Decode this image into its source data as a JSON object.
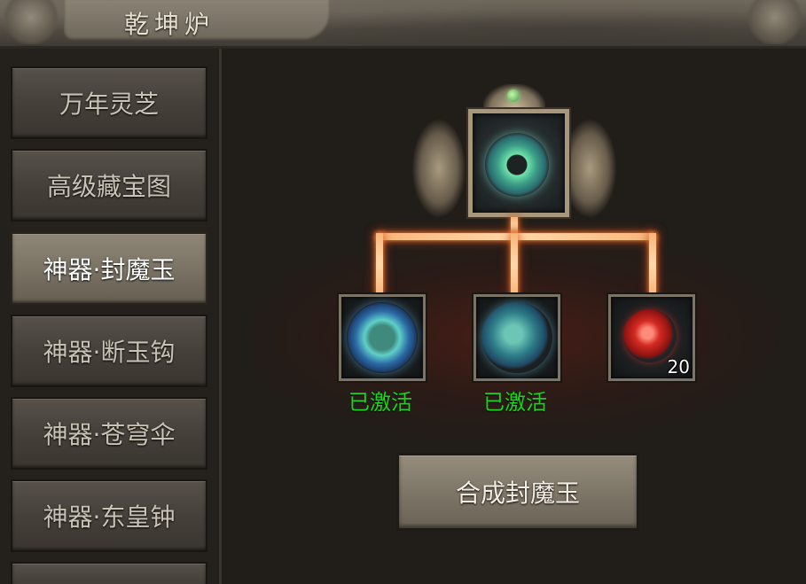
{
  "window": {
    "title": "乾坤炉"
  },
  "menu": {
    "items": [
      {
        "label": "万年灵芝",
        "active": false
      },
      {
        "label": "高级藏宝图",
        "active": false
      },
      {
        "label": "神器·封魔玉",
        "active": true
      },
      {
        "label": "神器·断玉钩",
        "active": false
      },
      {
        "label": "神器·苍穹伞",
        "active": false
      },
      {
        "label": "神器·东皇钟",
        "active": false
      }
    ]
  },
  "recipe": {
    "result_item_icon": "jade-disc-icon",
    "materials": [
      {
        "icon": "blue-jade-orb-icon",
        "status": "已激活",
        "count": ""
      },
      {
        "icon": "cloud-jade-orb-icon",
        "status": "已激活",
        "count": ""
      },
      {
        "icon": "red-spiral-stone-icon",
        "status": "",
        "count": "20"
      }
    ],
    "craft_button_label": "合成封魔玉"
  },
  "colors": {
    "status_active": "#19d619",
    "connector_glow": "#ff8a3a",
    "menu_active_bg": "#7b7364"
  }
}
